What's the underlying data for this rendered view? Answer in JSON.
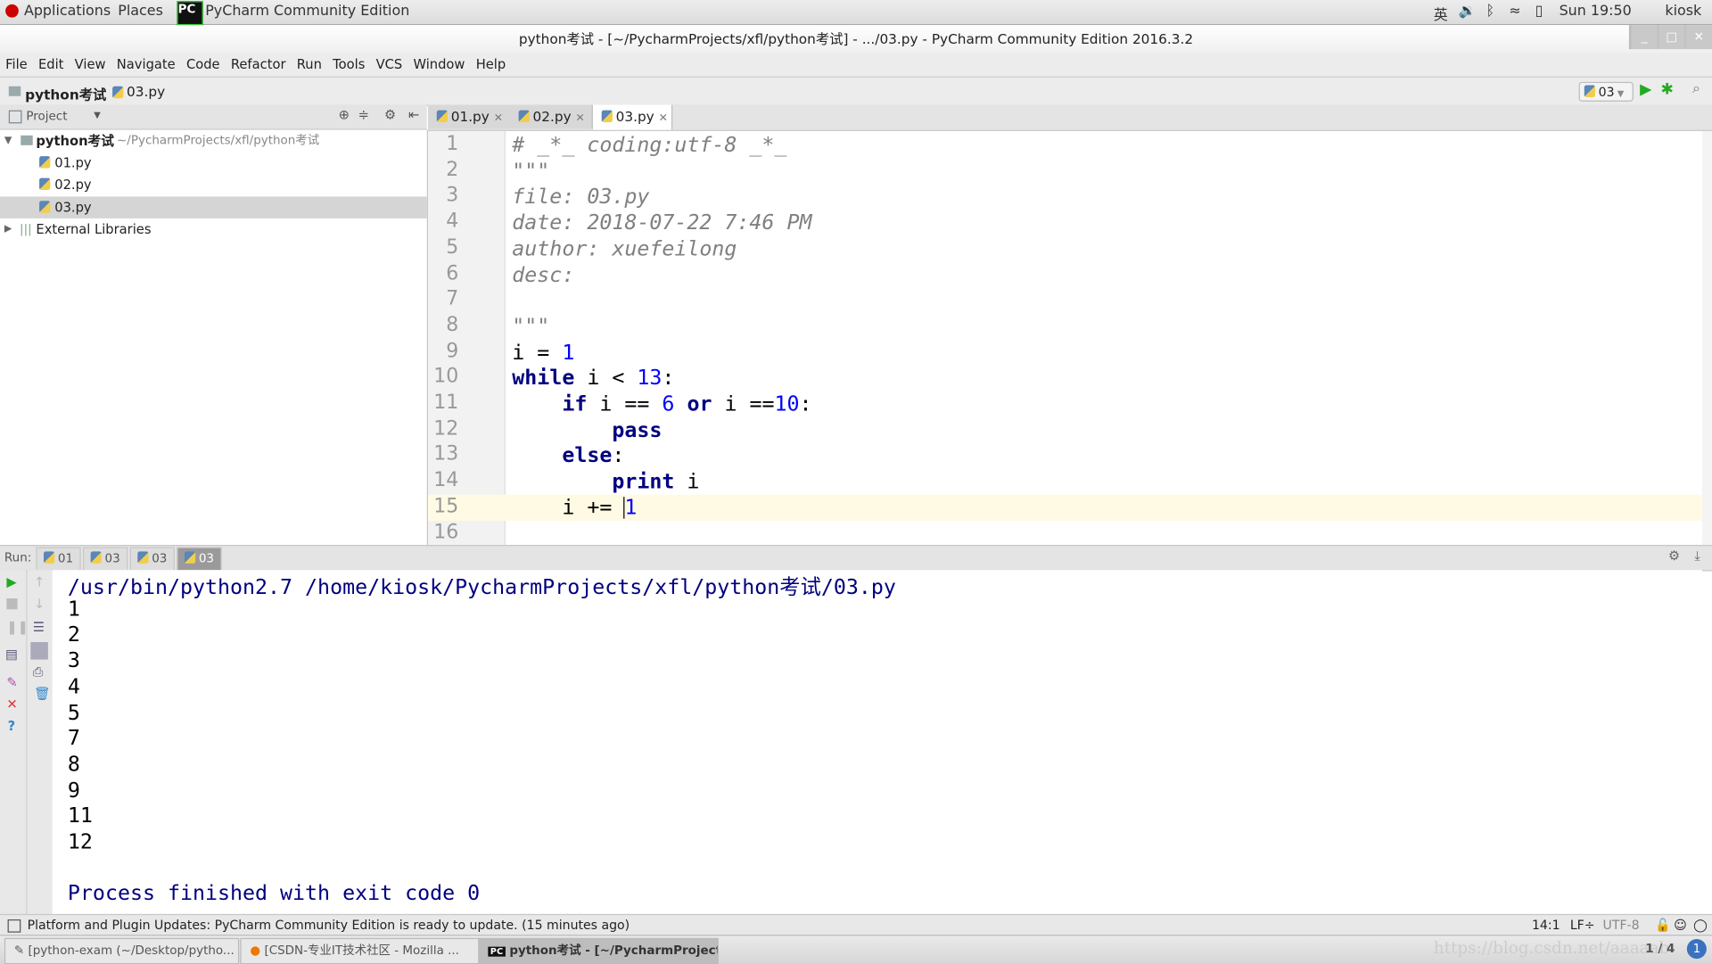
{
  "topbar": {
    "applications": "Applications",
    "places": "Places",
    "app_name": "PyCharm Community Edition",
    "input_method": "英",
    "clock": "Sun 19:50",
    "user": "kiosk"
  },
  "window": {
    "title": "python考试 - [~/PycharmProjects/xfl/python考试] - .../03.py - PyCharm Community Edition 2016.3.2"
  },
  "menu": [
    "File",
    "Edit",
    "View",
    "Navigate",
    "Code",
    "Refactor",
    "Run",
    "Tools",
    "VCS",
    "Window",
    "Help"
  ],
  "breadcrumb": {
    "project": "python考试",
    "file": "03.py"
  },
  "run_config": {
    "name": "03"
  },
  "project_panel": {
    "title": "Project",
    "root": "python考试",
    "root_path": "~/PycharmProjects/xfl/python考试",
    "files": [
      "01.py",
      "02.py",
      "03.py"
    ],
    "selected": "03.py",
    "external": "External Libraries"
  },
  "tabs": [
    {
      "label": "01.py"
    },
    {
      "label": "02.py"
    },
    {
      "label": "03.py",
      "active": true
    }
  ],
  "editor": {
    "current_line": 15,
    "lines": [
      [
        [
          "comment",
          "# _*_ coding:utf-8 _*_"
        ]
      ],
      [
        [
          "comment",
          "\"\"\""
        ]
      ],
      [
        [
          "comment",
          "file: 03.py"
        ]
      ],
      [
        [
          "comment",
          "date: 2018-07-22 7:46 PM"
        ]
      ],
      [
        [
          "comment",
          "author: xuefeilong"
        ]
      ],
      [
        [
          "comment",
          "desc:"
        ]
      ],
      [],
      [
        [
          "comment",
          "\"\"\""
        ]
      ],
      [
        [
          "plain",
          "i = "
        ],
        [
          "num",
          "1"
        ]
      ],
      [
        [
          "kw",
          "while"
        ],
        [
          "plain",
          " i < "
        ],
        [
          "num",
          "13"
        ],
        [
          "plain",
          ":"
        ]
      ],
      [
        [
          "plain",
          "    "
        ],
        [
          "kw",
          "if"
        ],
        [
          "plain",
          " i == "
        ],
        [
          "num",
          "6"
        ],
        [
          "plain",
          " "
        ],
        [
          "kw",
          "or"
        ],
        [
          "plain",
          " i =="
        ],
        [
          "num",
          "10"
        ],
        [
          "plain",
          ":"
        ]
      ],
      [
        [
          "plain",
          "        "
        ],
        [
          "kw",
          "pass"
        ]
      ],
      [
        [
          "plain",
          "    "
        ],
        [
          "kw",
          "else"
        ],
        [
          "plain",
          ":"
        ]
      ],
      [
        [
          "plain",
          "        "
        ],
        [
          "kw",
          "print"
        ],
        [
          "plain",
          " i"
        ]
      ],
      [
        [
          "plain",
          "    i += "
        ],
        [
          "num",
          "1"
        ]
      ],
      []
    ]
  },
  "run": {
    "label": "Run:",
    "tabs": [
      "01",
      "03",
      "03",
      "03"
    ],
    "active_tab": 3,
    "command": "/usr/bin/python2.7 /home/kiosk/PycharmProjects/xfl/python考试/03.py",
    "output": [
      "1",
      "2",
      "3",
      "4",
      "5",
      "7",
      "8",
      "9",
      "11",
      "12"
    ],
    "exit": "Process finished with exit code 0"
  },
  "statusbar": {
    "message": "Platform and Plugin Updates: PyCharm Community Edition is ready to update. (15 minutes ago)",
    "position": "14:1",
    "line_sep": "LF÷",
    "encoding": "UTF-8"
  },
  "taskbar": {
    "items": [
      "[python-exam (~/Desktop/pytho...",
      "[CSDN-专业IT技术社区 - Mozilla ...",
      "python考试 - [~/PycharmProject..."
    ],
    "active": 2,
    "workspace": "1 / 4",
    "watermark": "https://blog.csdn.net/aaaaab",
    "notifications": "1"
  },
  "colors": {
    "keyword": "#000080",
    "number": "#0000ff",
    "comment": "#808080",
    "output": "#000080",
    "current_line": "#fffae3"
  }
}
